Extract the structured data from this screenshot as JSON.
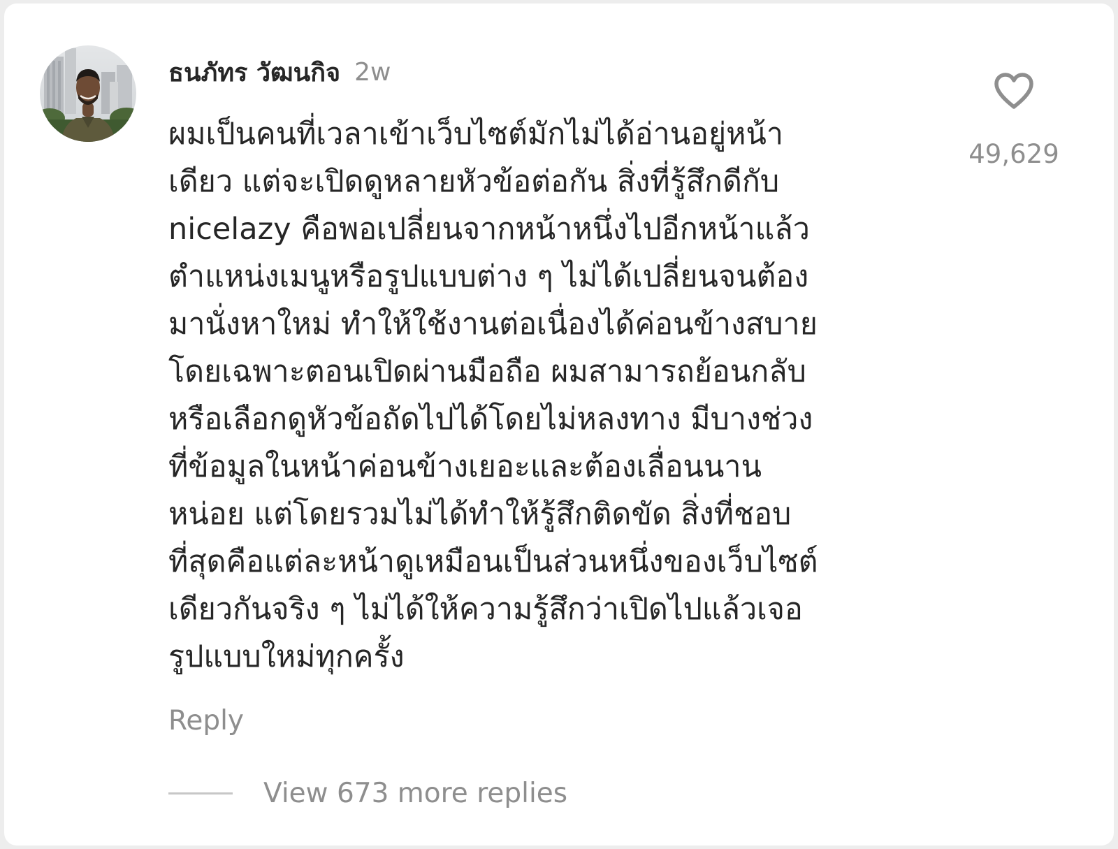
{
  "comment": {
    "username": "ธนภัทร วัฒนกิจ",
    "timestamp": "2w",
    "avatar_icon": "user-avatar-photo",
    "text_lines": [
      "ผมเป็นคนที่เวลาเข้าเว็บไซต์มักไม่ได้อ่านอยู่หน้า",
      "เดียว แต่จะเปิดดูหลายหัวข้อต่อกัน สิ่งที่รู้สึกดีกับ",
      "nicelazy คือพอเปลี่ยนจากหน้าหนึ่งไปอีกหน้าแล้ว",
      "ตำแหน่งเมนูหรือรูปแบบต่าง ๆ ไม่ได้เปลี่ยนจนต้อง",
      "มานั่งหาใหม่ ทำให้ใช้งานต่อเนื่องได้ค่อนข้างสบาย",
      "โดยเฉพาะตอนเปิดผ่านมือถือ ผมสามารถย้อนกลับ",
      "หรือเลือกดูหัวข้อถัดไปได้โดยไม่หลงทาง มีบางช่วง",
      "ที่ข้อมูลในหน้าค่อนข้างเยอะและต้องเลื่อนนาน",
      "หน่อย แต่โดยรวมไม่ได้ทำให้รู้สึกติดขัด สิ่งที่ชอบ",
      "ที่สุดคือแต่ละหน้าดูเหมือนเป็นส่วนหนึ่งของเว็บไซต์",
      "เดียวกันจริง ๆ ไม่ได้ให้ความรู้สึกว่าเปิดไปแล้วเจอ",
      "รูปแบบใหม่ทุกครั้ง"
    ],
    "like_icon": "heart-outline-icon",
    "like_count": "49,629",
    "reply_label": "Reply",
    "view_replies_label": "View 673 more replies"
  },
  "colors": {
    "background": "#ffffff",
    "page_border": "#ededed",
    "primary_text": "#262626",
    "secondary_text": "#8e8e8e",
    "divider": "#c7c7c7"
  }
}
